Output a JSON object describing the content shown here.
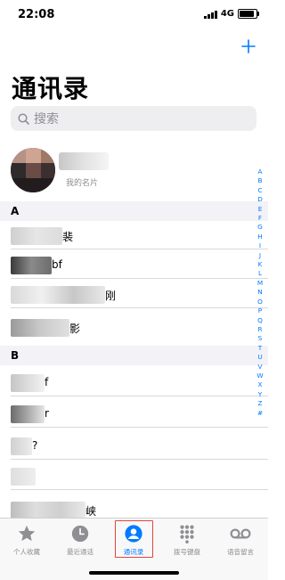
{
  "status": {
    "time": "22:08",
    "network": "4G"
  },
  "header": {
    "title": "通讯录",
    "add_icon": "plus-icon"
  },
  "search": {
    "placeholder": "搜索"
  },
  "my_card": {
    "label": "我的名片"
  },
  "sections": [
    {
      "letter": "A",
      "rows": [
        {
          "tail": "裴"
        },
        {
          "tail": "bf"
        },
        {
          "tail": "刚"
        },
        {
          "tail": "影"
        }
      ]
    },
    {
      "letter": "B",
      "rows": [
        {
          "tail": "f"
        },
        {
          "tail": "r"
        },
        {
          "tail": "?"
        },
        {
          "tail": ""
        },
        {
          "tail": "峡"
        }
      ]
    }
  ],
  "index_letters": [
    "A",
    "B",
    "C",
    "D",
    "E",
    "F",
    "G",
    "H",
    "I",
    "J",
    "K",
    "L",
    "M",
    "N",
    "O",
    "P",
    "Q",
    "R",
    "S",
    "T",
    "U",
    "V",
    "W",
    "X",
    "Y",
    "Z",
    "#"
  ],
  "tabs": [
    {
      "label": "个人收藏",
      "icon": "star-icon"
    },
    {
      "label": "最近通话",
      "icon": "clock-icon"
    },
    {
      "label": "通讯录",
      "icon": "person-circle-icon",
      "active": true
    },
    {
      "label": "拨号键盘",
      "icon": "keypad-icon"
    },
    {
      "label": "语音留言",
      "icon": "voicemail-icon"
    }
  ],
  "colors": {
    "accent": "#007aff",
    "highlight": "#e0463a",
    "section_bg": "#f2f2f7"
  }
}
